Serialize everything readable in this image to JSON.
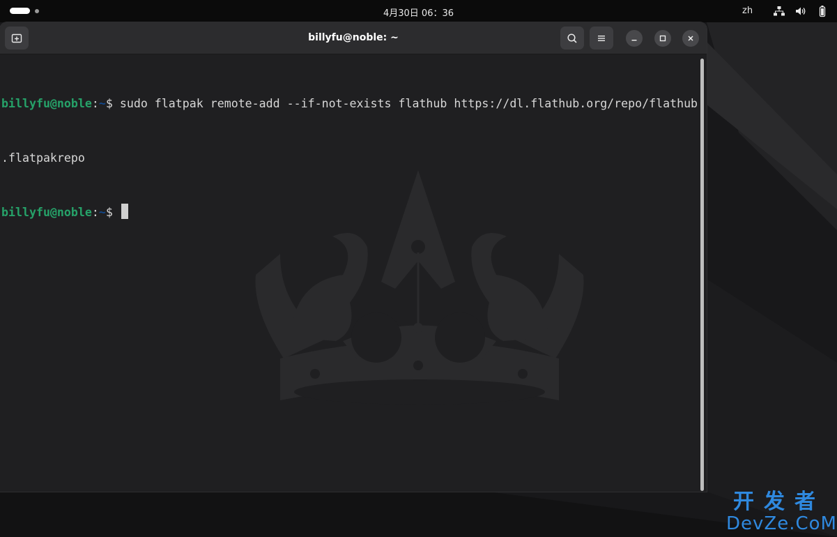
{
  "top_bar": {
    "clock": "4月30日  06：36",
    "input_language": "zh",
    "tray_icons": [
      "network-wired-icon",
      "volume-icon",
      "battery-icon"
    ]
  },
  "window": {
    "title": "billyfu@noble: ~",
    "header_buttons": [
      "new-tab-icon",
      "search-icon",
      "hamburger-menu-icon"
    ],
    "window_controls": [
      "minimize-icon",
      "maximize-icon",
      "close-icon"
    ]
  },
  "terminal": {
    "line1": {
      "user_host": "billyfu@noble",
      "colon": ":",
      "path": "~",
      "prompt": "$ ",
      "command": "sudo flatpak remote-add --if-not-exists flathub https://dl.flathub.org/repo/flathub"
    },
    "line2": {
      "text": ".flatpakrepo"
    },
    "line3": {
      "user_host": "billyfu@noble",
      "colon": ":",
      "path": "~",
      "prompt": "$ "
    }
  },
  "watermark": {
    "chinese": "开发者",
    "latin": "DevZe.CoM"
  },
  "colors": {
    "prompt_user": "#26a269",
    "prompt_path": "#12488b",
    "terminal_bg": "#1f1f21",
    "watermark": "#2f89df"
  }
}
